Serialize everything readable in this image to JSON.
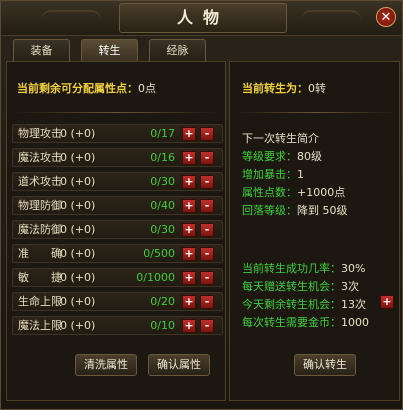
{
  "window": {
    "title": "人物",
    "close_glyph": "✕"
  },
  "tabs": [
    {
      "label": "装备",
      "active": false
    },
    {
      "label": "转生",
      "active": true
    },
    {
      "label": "经脉",
      "active": false
    }
  ],
  "left": {
    "points_label": "当前剩余可分配属性点：",
    "points_value": "0点",
    "attributes": [
      {
        "name": "物理攻击",
        "value": "0 (+0)",
        "max": "0/17"
      },
      {
        "name": "魔法攻击",
        "value": "0 (+0)",
        "max": "0/16"
      },
      {
        "name": "道术攻击",
        "value": "0 (+0)",
        "max": "0/30"
      },
      {
        "name": "物理防御",
        "value": "0 (+0)",
        "max": "0/40"
      },
      {
        "name": "魔法防御",
        "value": "0 (+0)",
        "max": "0/30"
      },
      {
        "name": "准　　确",
        "value": "0 (+0)",
        "max": "0/500"
      },
      {
        "name": "敏　　捷",
        "value": "0 (+0)",
        "max": "0/1000"
      },
      {
        "name": "生命上限",
        "value": "0 (+0)",
        "max": "0/20"
      },
      {
        "name": "魔法上限",
        "value": "0 (+0)",
        "max": "0/10"
      }
    ],
    "plus_glyph": "+",
    "minus_glyph": "-",
    "clear_button": "清洗属性",
    "confirm_button": "确认属性"
  },
  "right": {
    "current_label": "当前转生为：",
    "current_value": "0转",
    "next_title": "下一次转生简介",
    "level_req_label": "等级要求：",
    "level_req_value": "80级",
    "crit_label": "增加暴击：",
    "crit_value": "1",
    "attr_points_label": "属性点数：",
    "attr_points_value": "+1000点",
    "drop_level_label": "回落等级：",
    "drop_level_value": "降到 50级",
    "success_label": "当前转生成功几率：",
    "success_value": "30%",
    "daily_gift_label": "每天赠送转生机会：",
    "daily_gift_value": "3次",
    "remaining_label": "今天剩余转生机会：",
    "remaining_value": "13次",
    "gold_label": "每次转生需要金币：",
    "gold_value": "1000",
    "plus_glyph": "+",
    "confirm_button": "确认转生"
  }
}
